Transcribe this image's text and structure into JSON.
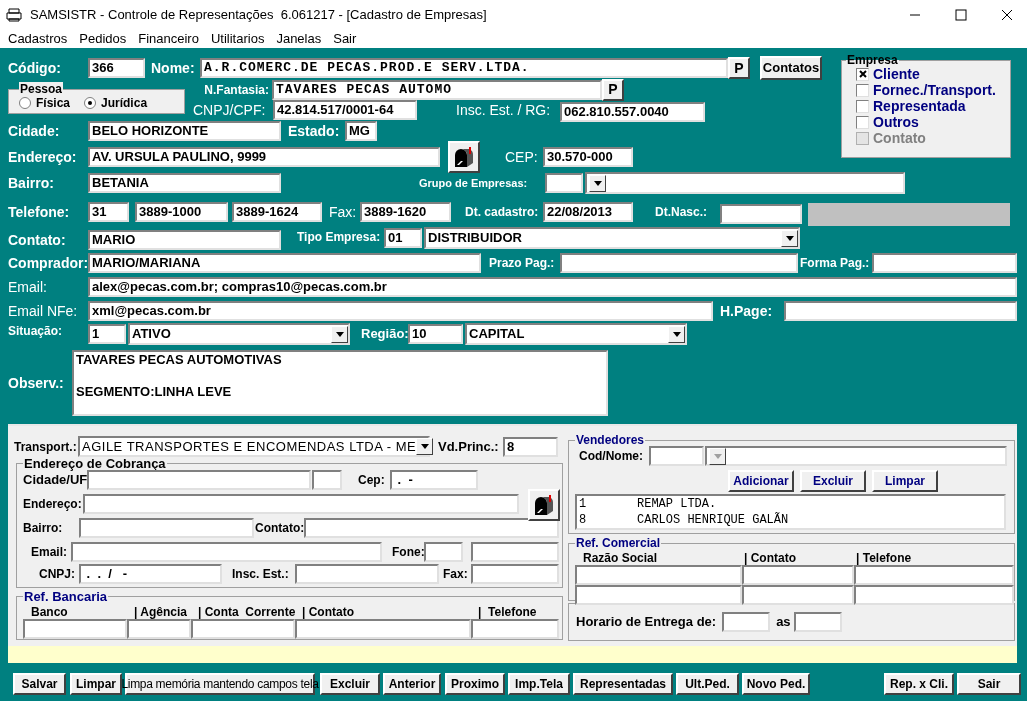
{
  "window": {
    "title": "SAMSISTR - Controle de Representações  6.061217 - [Cadastro de Empresas]"
  },
  "menu": [
    "Cadastros",
    "Pedidos",
    "Financeiro",
    "Utilitarios",
    "Janelas",
    "Sair"
  ],
  "codigo": {
    "label": "Código:",
    "value": "366"
  },
  "nome": {
    "label": "Nome:",
    "value": "A.R.COMERC.DE PECAS.PROD.E SERV.LTDA.",
    "lookup_button": "P"
  },
  "contatos_button": "Contatos",
  "pessoa": {
    "title": "Pessoa",
    "options": [
      {
        "label": "Física",
        "selected": false
      },
      {
        "label": "Jurídica",
        "selected": true
      }
    ]
  },
  "fantasia": {
    "label": "N.Fantasia:",
    "value": "TAVARES PECAS AUTOMO",
    "lookup_button": "P"
  },
  "cnpj_cpf": {
    "label": "CNPJ/CPF:",
    "value": "42.814.517/0001-64"
  },
  "insc_est_rg": {
    "label": "Insc. Est. / RG:",
    "value": "062.810.557.0040"
  },
  "empresa": {
    "title": "Empresa",
    "options": [
      {
        "label": "Cliente",
        "checked": true,
        "disabled": false
      },
      {
        "label": "Fornec./Transport.",
        "checked": false,
        "disabled": false
      },
      {
        "label": "Representada",
        "checked": false,
        "disabled": false
      },
      {
        "label": "Outros",
        "checked": false,
        "disabled": false
      },
      {
        "label": "Contato",
        "checked": false,
        "disabled": true
      }
    ]
  },
  "cidade": {
    "label": "Cidade:",
    "value": "BELO HORIZONTE"
  },
  "estado": {
    "label": "Estado:",
    "value": "MG"
  },
  "endereco": {
    "label": "Endereço:",
    "value": "AV. URSULA PAULINO, 9999"
  },
  "cep": {
    "label": "CEP:",
    "value": "30.570-000"
  },
  "bairro": {
    "label": "Bairro:",
    "value": "BETANIA"
  },
  "grupo_empresas": {
    "label": "Grupo de Empresas:"
  },
  "telefone": {
    "label": "Telefone:",
    "values": [
      "31",
      "3889-1000",
      "3889-1624"
    ]
  },
  "fax": {
    "label": "Fax:",
    "value": "3889-1620"
  },
  "dt_cadastro": {
    "label": "Dt. cadastro:",
    "value": "22/08/2013"
  },
  "dt_nasc": {
    "label": "Dt.Nasc.:"
  },
  "contato": {
    "label": "Contato:",
    "value": "MARIO"
  },
  "tipo_empresa": {
    "label": "Tipo Empresa:",
    "code": "01",
    "value": "DISTRIBUIDOR"
  },
  "comprador": {
    "label": "Comprador:",
    "value": "MARIO/MARIANA"
  },
  "prazo_pag": {
    "label": "Prazo Pag.:"
  },
  "forma_pag": {
    "label": "Forma Pag.:"
  },
  "email": {
    "label": "Email:",
    "value": "alex@pecas.com.br; compras10@pecas.com.br"
  },
  "email_nfe": {
    "label": "Email NFe:",
    "value": "xml@pecas.com.br"
  },
  "h_page": {
    "label": "H.Page:"
  },
  "situacao": {
    "label": "Situação:",
    "code": "1",
    "value": "ATIVO"
  },
  "regiao": {
    "label": "Região:",
    "code": "10",
    "value": "CAPITAL"
  },
  "observacao": {
    "label": "Observ.:",
    "value": "TAVARES PECAS AUTOMOTIVAS\n\nSEGMENTO:LINHA LEVE"
  },
  "transport": {
    "label": "Transport.:",
    "value": "AGILE TRANSPORTES E ENCOMENDAS LTDA - ME"
  },
  "vd_princ": {
    "label": "Vd.Princ.:",
    "value": "8"
  },
  "endereco_cobranca": {
    "title": "Endereço de Cobrança",
    "cidade_uf": "Cidade/UF",
    "cep": {
      "label": "Cep:",
      "value": " .  -"
    },
    "endereco": "Endereço:",
    "bairro": "Bairro:",
    "contato": "Contato:",
    "email": "Email:",
    "fone": "Fone:",
    "cnpj": {
      "label": "CNPJ:",
      "value": " .  .  /   -"
    },
    "insc_est": "Insc. Est.:",
    "fax": "Fax:"
  },
  "ref_bancaria": {
    "title": "Ref. Bancaria",
    "columns": [
      "Banco",
      "| Agência",
      "| Conta  Corrente",
      "| Contato",
      "|  Telefone"
    ]
  },
  "vendedores": {
    "title": "Vendedores",
    "label": "Cod/Nome:",
    "buttons": [
      "Adicionar",
      "Excluir",
      "Limpar"
    ],
    "list": [
      {
        "code": "1",
        "name": "REMAP LTDA."
      },
      {
        "code": "8",
        "name": "CARLOS HENRIQUE GALÃN"
      }
    ]
  },
  "ref_comercial": {
    "title": "Ref. Comercial",
    "columns": [
      "Razão Social",
      "| Contato",
      "| Telefone"
    ]
  },
  "horario_entrega": {
    "label": "Horario de Entrega de:",
    "separator": "as"
  },
  "buttons": [
    "Salvar",
    "Limpar",
    "Limpa memória mantendo campos tela",
    "Excluir",
    "Anterior",
    "Proximo",
    "Imp.Tela",
    "Representadas",
    "Ult.Ped.",
    "Novo Ped.",
    "Rep. x Cli.",
    "Sair"
  ]
}
